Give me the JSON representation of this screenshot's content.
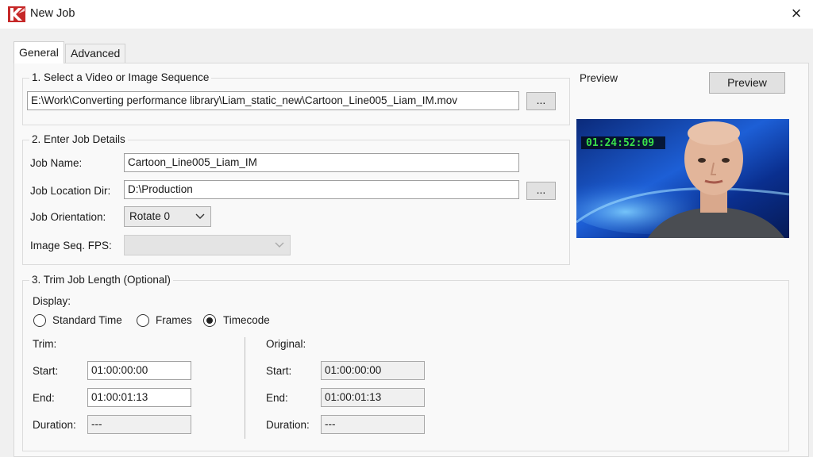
{
  "window": {
    "title": "New Job",
    "close_label": "×"
  },
  "tabs": [
    {
      "label": "General",
      "active": true
    },
    {
      "label": "Advanced",
      "active": false
    }
  ],
  "section1": {
    "title": "1. Select a Video or Image Sequence",
    "file_path": "E:\\Work\\Converting performance library\\Liam_static_new\\Cartoon_Line005_Liam_IM.mov",
    "browse_label": "..."
  },
  "section2": {
    "title": "2. Enter Job Details",
    "job_name_label": "Job Name:",
    "job_name_value": "Cartoon_Line005_Liam_IM",
    "job_location_label": "Job Location Dir:",
    "job_location_value": "D:\\Production",
    "browse_label": "...",
    "orientation_label": "Job Orientation:",
    "orientation_value": "Rotate 0",
    "fps_label": "Image Seq. FPS:",
    "fps_value": ""
  },
  "preview": {
    "label": "Preview",
    "button_label": "Preview",
    "timecode_overlay": "01:24:52:09"
  },
  "section3": {
    "title": "3. Trim Job Length (Optional)",
    "display_label": "Display:",
    "display_options": [
      {
        "label": "Standard Time",
        "selected": false
      },
      {
        "label": "Frames",
        "selected": false
      },
      {
        "label": "Timecode",
        "selected": true
      }
    ],
    "trim": {
      "heading": "Trim:",
      "start_label": "Start:",
      "start_value": "01:00:00:00",
      "end_label": "End:",
      "end_value": "01:00:01:13",
      "duration_label": "Duration:",
      "duration_value": "---"
    },
    "original": {
      "heading": "Original:",
      "start_label": "Start:",
      "start_value": "01:00:00:00",
      "end_label": "End:",
      "end_value": "01:00:01:13",
      "duration_label": "Duration:",
      "duration_value": "---"
    }
  }
}
